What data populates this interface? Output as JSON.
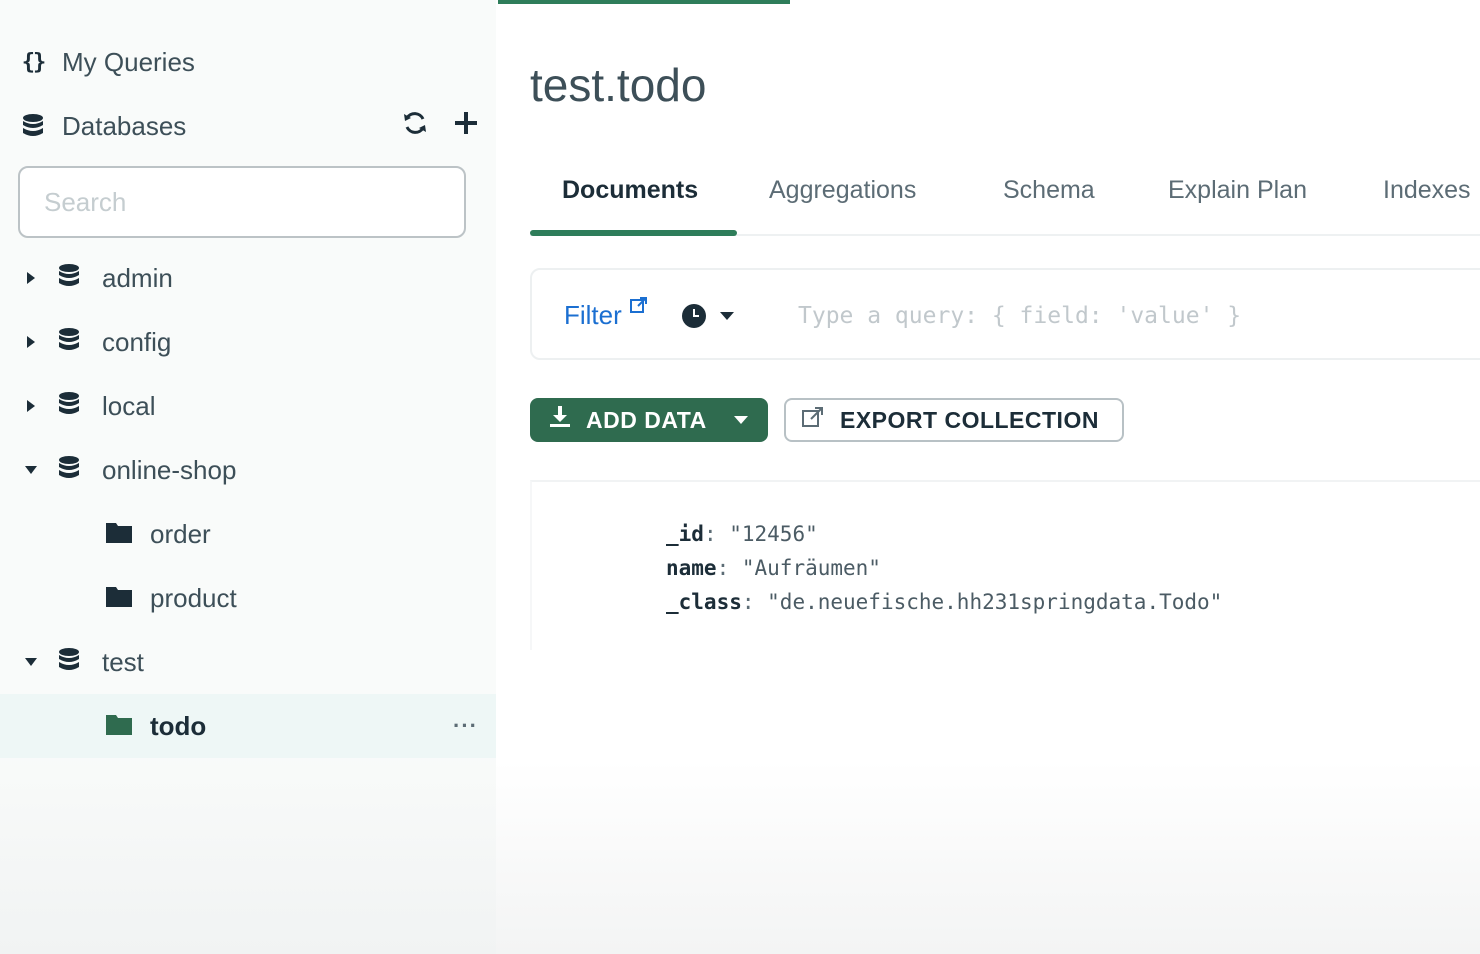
{
  "sidebar": {
    "my_queries_label": "My Queries",
    "databases_label": "Databases",
    "search_placeholder": "Search",
    "databases": [
      {
        "name": "admin",
        "expanded": false
      },
      {
        "name": "config",
        "expanded": false
      },
      {
        "name": "local",
        "expanded": false
      },
      {
        "name": "online-shop",
        "expanded": true,
        "collections": [
          "order",
          "product"
        ]
      },
      {
        "name": "test",
        "expanded": true,
        "collections": [
          "todo"
        ]
      }
    ],
    "active_collection": "todo",
    "more_label": "···"
  },
  "main": {
    "title": "test.todo",
    "tabs": [
      {
        "label": "Documents",
        "active": true
      },
      {
        "label": "Aggregations",
        "active": false
      },
      {
        "label": "Schema",
        "active": false
      },
      {
        "label": "Explain Plan",
        "active": false
      },
      {
        "label": "Indexes",
        "active": false
      }
    ],
    "filter": {
      "label": "Filter",
      "placeholder": "Type a query: { field: 'value' }"
    },
    "buttons": {
      "add_data": "ADD DATA",
      "export_collection": "EXPORT COLLECTION"
    },
    "document": [
      {
        "key": "_id",
        "value": "\"12456\""
      },
      {
        "key": "name",
        "value": "\"Aufräumen\""
      },
      {
        "key": "_class",
        "value": "\"de.neuefische.hh231springdata.Todo\""
      }
    ]
  },
  "colors": {
    "accent_green": "#2e7d5a",
    "button_green": "#2f6b4f",
    "link_blue": "#1b6fd1",
    "active_row": "#eef7f6"
  }
}
